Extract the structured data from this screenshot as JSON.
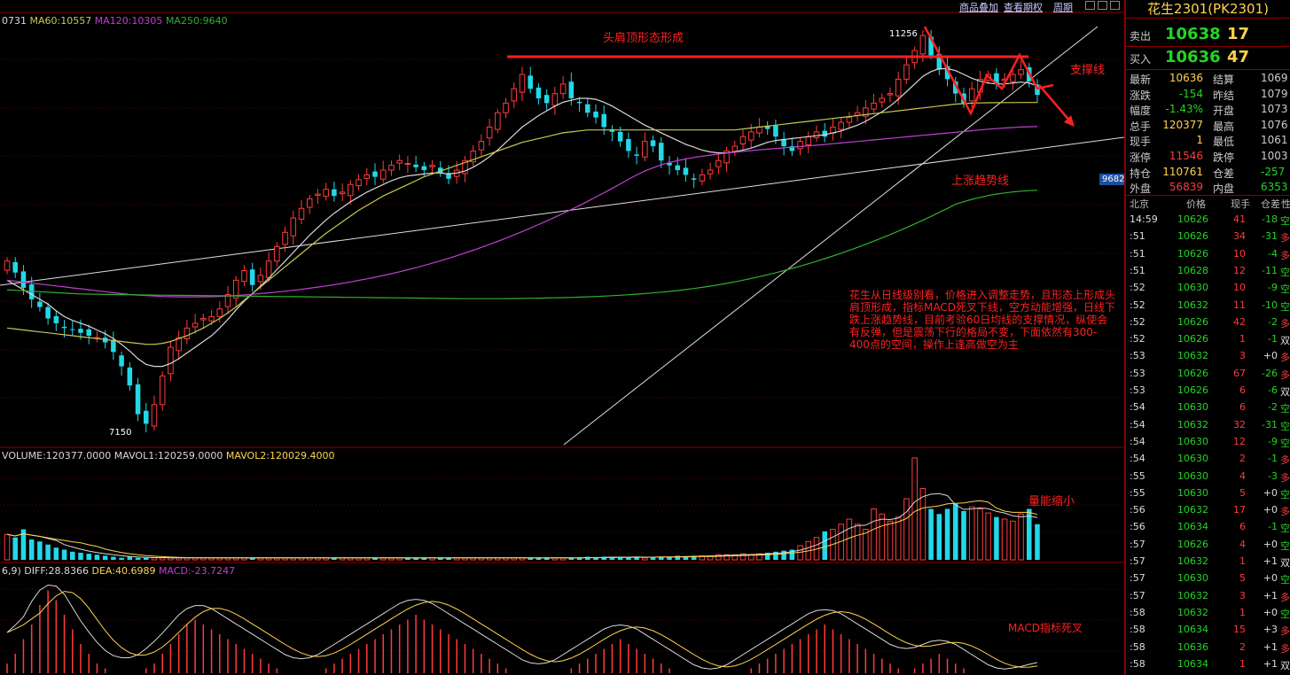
{
  "menu": {
    "overlay": "商品叠加",
    "options": "查看期权",
    "period": "周期"
  },
  "ma_legend": {
    "ma_a": "0731",
    "ma60": "MA60:10557",
    "ma120": "MA120:10305",
    "ma250": "MA250:9640"
  },
  "vol_legend": {
    "volume": "VOLUME:120377.0000",
    "mavol1": "MAVOL1:120259.0000",
    "mavol2": "MAVOL2:120029.4000"
  },
  "macd_legend": {
    "params": "6,9)",
    "diff": "DIFF:28.8366",
    "dea": "DEA:40.6989",
    "macd": "MACD:-23.7247"
  },
  "annotations": {
    "head_shoulders": "头肩顶形态形成",
    "support": "支撑线",
    "uptrend": "上涨趋势线",
    "volume_shrink": "量能缩小",
    "macd_cross": "MACD指标死叉",
    "note_1": "花生从日线级别看，价格进入调整走势，且形态上形成头肩顶形成，指标MACD死叉下线，空方动能增强，日线下跌上涨趋势线，目前考验60日均线的支撑情况，纵使会有反弹，但是震荡下行的格局不变",
    "note_2": "，下面依然有300-400点的空间，操作上逢高做空为主"
  },
  "price_tags": {
    "high": "11256",
    "low": "7150",
    "last": "9682"
  },
  "colors": {
    "up": "#ff3b3b",
    "down": "#22d8e8",
    "ma_white": "#d8d8d8",
    "ma60": "#c8c850",
    "ma120": "#c040d0",
    "ma250": "#30b030",
    "annot": "#ff2020"
  },
  "panel": {
    "title": "花生2301(PK2301)",
    "sell": {
      "label": "卖出",
      "price": "10638",
      "qty": "17"
    },
    "buy": {
      "label": "买入",
      "price": "10636",
      "qty": "47"
    },
    "quote": [
      {
        "l1": "最新",
        "v1": "10636",
        "l2": "结算",
        "v2": "1069"
      },
      {
        "l1": "涨跌",
        "v1": "-154",
        "l2": "昨结",
        "v2": "1079"
      },
      {
        "l1": "幅度",
        "v1": "-1.43%",
        "l2": "开盘",
        "v2": "1073"
      },
      {
        "l1": "总手",
        "v1": "120377",
        "l2": "最高",
        "v2": "1076"
      },
      {
        "l1": "现手",
        "v1": "1",
        "l2": "最低",
        "v2": "1061"
      },
      {
        "l1": "涨停",
        "v1": "11546",
        "l2": "跌停",
        "v2": "1003"
      },
      {
        "l1": "持仓",
        "v1": "110761",
        "l2": "仓差",
        "v2": "-257"
      },
      {
        "l1": "外盘",
        "v1": "56839",
        "l2": "内盘",
        "v2": "6353"
      }
    ],
    "tick_header": {
      "time": "北京",
      "price": "价格",
      "qty": "现手",
      "oi": "仓差",
      "nature": "性"
    },
    "ticks": [
      {
        "t": "14:59",
        "p": "10626",
        "q": "41",
        "oi": "-18",
        "n": "空"
      },
      {
        "t": ":51",
        "p": "10626",
        "q": "34",
        "oi": "-31",
        "n": "多"
      },
      {
        "t": ":51",
        "p": "10626",
        "q": "10",
        "oi": "-4",
        "n": "多"
      },
      {
        "t": ":51",
        "p": "10628",
        "q": "12",
        "oi": "-11",
        "n": "空"
      },
      {
        "t": ":52",
        "p": "10630",
        "q": "10",
        "oi": "-9",
        "n": "空"
      },
      {
        "t": ":52",
        "p": "10632",
        "q": "11",
        "oi": "-10",
        "n": "空"
      },
      {
        "t": ":52",
        "p": "10626",
        "q": "42",
        "oi": "-2",
        "n": "多"
      },
      {
        "t": ":52",
        "p": "10626",
        "q": "1",
        "oi": "-1",
        "n": "双"
      },
      {
        "t": ":53",
        "p": "10632",
        "q": "3",
        "oi": "+0",
        "n": "多"
      },
      {
        "t": ":53",
        "p": "10626",
        "q": "67",
        "oi": "-26",
        "n": "多"
      },
      {
        "t": ":53",
        "p": "10626",
        "q": "6",
        "oi": "-6",
        "n": "双"
      },
      {
        "t": ":54",
        "p": "10630",
        "q": "6",
        "oi": "-2",
        "n": "空"
      },
      {
        "t": ":54",
        "p": "10632",
        "q": "32",
        "oi": "-31",
        "n": "空"
      },
      {
        "t": ":54",
        "p": "10630",
        "q": "12",
        "oi": "-9",
        "n": "空"
      },
      {
        "t": ":54",
        "p": "10630",
        "q": "2",
        "oi": "-1",
        "n": "多"
      },
      {
        "t": ":55",
        "p": "10630",
        "q": "4",
        "oi": "-3",
        "n": "多"
      },
      {
        "t": ":55",
        "p": "10630",
        "q": "5",
        "oi": "+0",
        "n": "空"
      },
      {
        "t": ":56",
        "p": "10632",
        "q": "17",
        "oi": "+0",
        "n": "多"
      },
      {
        "t": ":56",
        "p": "10634",
        "q": "6",
        "oi": "-1",
        "n": "空"
      },
      {
        "t": ":57",
        "p": "10626",
        "q": "4",
        "oi": "+0",
        "n": "空"
      },
      {
        "t": ":57",
        "p": "10632",
        "q": "1",
        "oi": "+1",
        "n": "双"
      },
      {
        "t": ":57",
        "p": "10630",
        "q": "5",
        "oi": "+0",
        "n": "空"
      },
      {
        "t": ":57",
        "p": "10632",
        "q": "3",
        "oi": "+1",
        "n": "多"
      },
      {
        "t": ":58",
        "p": "10632",
        "q": "1",
        "oi": "+0",
        "n": "空"
      },
      {
        "t": ":58",
        "p": "10634",
        "q": "15",
        "oi": "+3",
        "n": "多"
      },
      {
        "t": ":58",
        "p": "10636",
        "q": "2",
        "oi": "+1",
        "n": "多"
      },
      {
        "t": ":58",
        "p": "10634",
        "q": "1",
        "oi": "+1",
        "n": "双"
      }
    ]
  },
  "chart_data": {
    "type": "candlestick",
    "price_range_shown": [
      7150,
      11256
    ],
    "closes": [
      8900,
      8780,
      8620,
      8500,
      8420,
      8300,
      8250,
      8200,
      8180,
      8150,
      8120,
      8100,
      8050,
      7950,
      7800,
      7600,
      7300,
      7200,
      7400,
      7700,
      8000,
      8100,
      8200,
      8250,
      8300,
      8320,
      8400,
      8550,
      8700,
      8800,
      8650,
      8750,
      8900,
      9050,
      9200,
      9350,
      9450,
      9550,
      9600,
      9650,
      9580,
      9620,
      9700,
      9750,
      9800,
      9780,
      9850,
      9900,
      9950,
      9920,
      9880,
      9850,
      9900,
      9820,
      9760,
      9850,
      9950,
      10050,
      10150,
      10300,
      10450,
      10550,
      10700,
      10850,
      10700,
      10600,
      10550,
      10650,
      10750,
      10600,
      10550,
      10450,
      10400,
      10300,
      10250,
      10150,
      10050,
      10000,
      10150,
      10100,
      9950,
      9900,
      9850,
      9800,
      9750,
      9800,
      9850,
      9950,
      10050,
      10100,
      10200,
      10250,
      10300,
      10280,
      10200,
      10100,
      10050,
      10150,
      10200,
      10250,
      10200,
      10300,
      10350,
      10400,
      10450,
      10500,
      10550,
      10600,
      10650,
      10800,
      10950,
      11100,
      11256,
      11050,
      10900,
      10800,
      10650,
      10550,
      10700,
      10800,
      10850,
      10750,
      10800,
      10850,
      10900,
      10780,
      10636
    ],
    "ma_white": [
      8700,
      8650,
      8600,
      8550,
      8500,
      8450,
      8380,
      8320,
      8280,
      8250,
      8220,
      8180,
      8140,
      8090,
      8030,
      7960,
      7880,
      7820,
      7800,
      7800,
      7830,
      7880,
      7940,
      8000,
      8060,
      8120,
      8200,
      8290,
      8390,
      8480,
      8560,
      8640,
      8720,
      8810,
      8900,
      8990,
      9080,
      9170,
      9250,
      9330,
      9400,
      9460,
      9520,
      9570,
      9620,
      9660,
      9700,
      9740,
      9770,
      9790,
      9800,
      9810,
      9820,
      9820,
      9810,
      9820,
      9840,
      9880,
      9930,
      9990,
      10060,
      10140,
      10220,
      10300,
      10360,
      10420,
      10470,
      10520,
      10560,
      10580,
      10600,
      10600,
      10590,
      10560,
      10520,
      10470,
      10420,
      10370,
      10320,
      10280,
      10240,
      10200,
      10160,
      10120,
      10090,
      10060,
      10040,
      10030,
      10030,
      10040,
      10060,
      10080,
      10110,
      10140,
      10160,
      10170,
      10180,
      10190,
      10200,
      10210,
      10220,
      10240,
      10260,
      10290,
      10320,
      10360,
      10410,
      10460,
      10520,
      10590,
      10670,
      10750,
      10830,
      10880,
      10910,
      10910,
      10890,
      10850,
      10810,
      10780,
      10760,
      10750,
      10750,
      10760,
      10770,
      10760,
      10730
    ],
    "ma60": [
      8200,
      8190,
      8180,
      8170,
      8160,
      8150,
      8140,
      8130,
      8120,
      8110,
      8100,
      8090,
      8080,
      8070,
      8060,
      8050,
      8040,
      8030,
      8030,
      8040,
      8060,
      8090,
      8120,
      8160,
      8200,
      8250,
      8300,
      8360,
      8420,
      8490,
      8560,
      8630,
      8700,
      8770,
      8840,
      8910,
      8980,
      9050,
      9120,
      9190,
      9250,
      9310,
      9370,
      9430,
      9480,
      9530,
      9580,
      9620,
      9660,
      9700,
      9740,
      9780,
      9810,
      9840,
      9870,
      9900,
      9930,
      9960,
      9990,
      10020,
      10050,
      10080,
      10110,
      10140,
      10160,
      10180,
      10200,
      10220,
      10240,
      10250,
      10260,
      10270,
      10270,
      10270,
      10270,
      10270,
      10270,
      10270,
      10270,
      10270,
      10270,
      10270,
      10270,
      10270,
      10270,
      10270,
      10270,
      10270,
      10270,
      10270,
      10280,
      10290,
      10300,
      10310,
      10320,
      10330,
      10340,
      10350,
      10360,
      10370,
      10380,
      10390,
      10400,
      10410,
      10420,
      10430,
      10440,
      10450,
      10460,
      10470,
      10480,
      10490,
      10500,
      10510,
      10520,
      10530,
      10540,
      10545,
      10550,
      10552,
      10554,
      10555,
      10556,
      10556,
      10557,
      10557,
      10557
    ],
    "ma120": [
      8700,
      8690,
      8680,
      8670,
      8660,
      8650,
      8640,
      8630,
      8620,
      8610,
      8600,
      8590,
      8580,
      8570,
      8560,
      8550,
      8545,
      8540,
      8535,
      8530,
      8528,
      8526,
      8525,
      8525,
      8526,
      8528,
      8530,
      8535,
      8540,
      8546,
      8553,
      8560,
      8568,
      8576,
      8585,
      8595,
      8605,
      8616,
      8628,
      8640,
      8653,
      8667,
      8682,
      8698,
      8714,
      8731,
      8749,
      8768,
      8788,
      8809,
      8831,
      8854,
      8878,
      8903,
      8929,
      8956,
      8984,
      9013,
      9043,
      9074,
      9106,
      9139,
      9173,
      9208,
      9244,
      9281,
      9319,
      9358,
      9398,
      9439,
      9481,
      9524,
      9568,
      9613,
      9659,
      9706,
      9754,
      9800,
      9840,
      9875,
      9905,
      9930,
      9950,
      9967,
      9982,
      9995,
      10007,
      10018,
      10028,
      10037,
      10046,
      10054,
      10062,
      10069,
      10076,
      10083,
      10090,
      10097,
      10104,
      10111,
      10118,
      10126,
      10134,
      10142,
      10150,
      10158,
      10166,
      10174,
      10182,
      10190,
      10198,
      10206,
      10214,
      10222,
      10230,
      10238,
      10246,
      10254,
      10262,
      10270,
      10278,
      10284,
      10290,
      10295,
      10300,
      10303,
      10305
    ],
    "ma250": [
      8600,
      8595,
      8590,
      8585,
      8580,
      8575,
      8570,
      8565,
      8560,
      8557,
      8555,
      8553,
      8551,
      8550,
      8549,
      8548,
      8547,
      8546,
      8545,
      8544,
      8543,
      8542,
      8541,
      8540,
      8539,
      8538,
      8537,
      8536,
      8535,
      8534,
      8533,
      8532,
      8531,
      8530,
      8529,
      8528,
      8527,
      8526,
      8525,
      8524,
      8523,
      8522,
      8521,
      8520,
      8519,
      8518,
      8517,
      8516,
      8515,
      8514,
      8513,
      8512,
      8511,
      8510,
      8509,
      8508,
      8507,
      8507,
      8507,
      8507,
      8507,
      8508,
      8509,
      8510,
      8511,
      8512,
      8514,
      8516,
      8518,
      8520,
      8523,
      8526,
      8530,
      8534,
      8538,
      8543,
      8548,
      8554,
      8560,
      8567,
      8575,
      8583,
      8592,
      8602,
      8613,
      8625,
      8638,
      8652,
      8667,
      8683,
      8700,
      8718,
      8737,
      8757,
      8778,
      8800,
      8823,
      8847,
      8872,
      8898,
      8925,
      8953,
      8982,
      9012,
      9043,
      9075,
      9108,
      9142,
      9177,
      9213,
      9250,
      9288,
      9327,
      9367,
      9408,
      9450,
      9493,
      9520,
      9545,
      9565,
      9585,
      9600,
      9612,
      9622,
      9630,
      9636,
      9640
    ],
    "volume_rel": [
      0.25,
      0.22,
      0.3,
      0.2,
      0.18,
      0.15,
      0.12,
      0.1,
      0.08,
      0.07,
      0.06,
      0.05,
      0.04,
      0.03,
      0.02,
      0.03,
      0.02,
      0.02,
      0.02,
      0.02,
      0.02,
      0.02,
      0.02,
      0.02,
      0.02,
      0.02,
      0.02,
      0.02,
      0.02,
      0.02,
      0.02,
      0.02,
      0.02,
      0.02,
      0.02,
      0.02,
      0.02,
      0.02,
      0.02,
      0.02,
      0.02,
      0.02,
      0.02,
      0.02,
      0.02,
      0.02,
      0.02,
      0.02,
      0.02,
      0.02,
      0.02,
      0.02,
      0.02,
      0.02,
      0.02,
      0.02,
      0.02,
      0.02,
      0.02,
      0.02,
      0.02,
      0.02,
      0.02,
      0.02,
      0.02,
      0.02,
      0.02,
      0.02,
      0.02,
      0.02,
      0.02,
      0.03,
      0.02,
      0.03,
      0.03,
      0.02,
      0.03,
      0.03,
      0.02,
      0.03,
      0.03,
      0.03,
      0.04,
      0.03,
      0.04,
      0.04,
      0.04,
      0.05,
      0.05,
      0.05,
      0.06,
      0.05,
      0.06,
      0.07,
      0.08,
      0.09,
      0.1,
      0.14,
      0.18,
      0.22,
      0.28,
      0.3,
      0.35,
      0.4,
      0.35,
      0.3,
      0.5,
      0.45,
      0.38,
      0.42,
      0.6,
      1.0,
      0.7,
      0.5,
      0.45,
      0.5,
      0.55,
      0.48,
      0.52,
      0.5,
      0.46,
      0.42,
      0.4,
      0.38,
      0.45,
      0.5,
      0.35
    ],
    "macd_rel": [
      0.1,
      0.2,
      0.35,
      0.5,
      0.7,
      0.85,
      0.75,
      0.6,
      0.45,
      0.3,
      0.2,
      0.1,
      0.05,
      -0.05,
      -0.1,
      -0.05,
      0.0,
      0.05,
      0.1,
      0.2,
      0.3,
      0.4,
      0.5,
      0.55,
      0.5,
      0.45,
      0.4,
      0.35,
      0.3,
      0.25,
      0.2,
      0.15,
      0.1,
      0.05,
      0.0,
      -0.05,
      -0.1,
      -0.05,
      0.0,
      0.05,
      0.1,
      0.15,
      0.2,
      0.25,
      0.3,
      0.35,
      0.4,
      0.45,
      0.5,
      0.55,
      0.6,
      0.55,
      0.5,
      0.45,
      0.4,
      0.35,
      0.3,
      0.25,
      0.2,
      0.15,
      0.1,
      0.05,
      0.0,
      -0.05,
      -0.1,
      -0.15,
      -0.1,
      -0.05,
      0.0,
      0.05,
      0.1,
      0.15,
      0.2,
      0.25,
      0.3,
      0.35,
      0.3,
      0.25,
      0.2,
      0.15,
      0.1,
      0.05,
      0.0,
      -0.05,
      -0.1,
      -0.15,
      -0.2,
      -0.15,
      -0.1,
      -0.05,
      0.0,
      0.05,
      0.1,
      0.15,
      0.2,
      0.25,
      0.3,
      0.35,
      0.4,
      0.45,
      0.5,
      0.45,
      0.4,
      0.35,
      0.3,
      0.25,
      0.2,
      0.15,
      0.1,
      0.05,
      0.0,
      0.05,
      0.1,
      0.15,
      0.2,
      0.15,
      0.1,
      0.05,
      0.0,
      -0.05,
      -0.1,
      -0.15,
      -0.2,
      -0.15,
      -0.1,
      -0.05,
      -0.08
    ]
  }
}
